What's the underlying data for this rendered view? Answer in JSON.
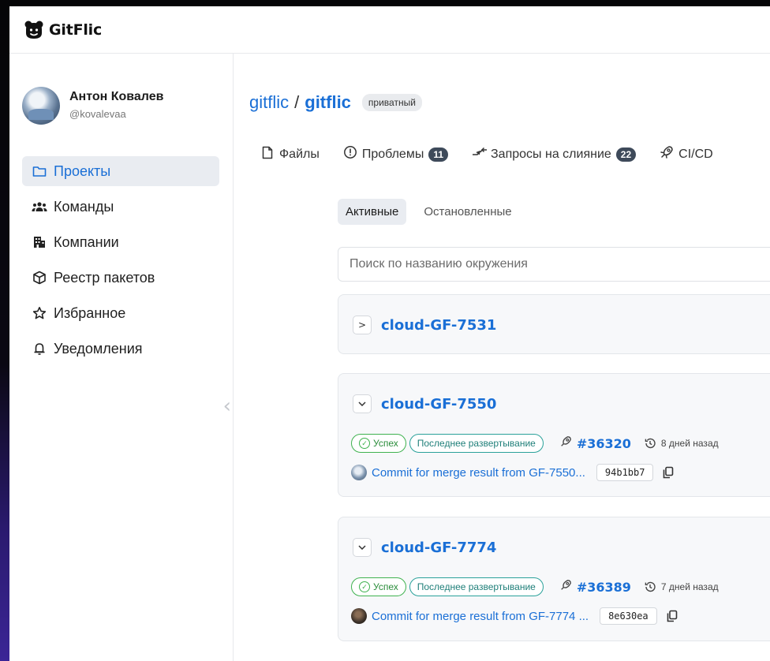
{
  "app": {
    "name": "GitFlic"
  },
  "user": {
    "name": "Антон Ковалев",
    "login": "@kovalevaa"
  },
  "sidebar": {
    "items": [
      {
        "label": "Проекты",
        "icon": "folder-icon",
        "active": true
      },
      {
        "label": "Команды",
        "icon": "users-icon"
      },
      {
        "label": "Компании",
        "icon": "buildings-icon"
      },
      {
        "label": "Реестр пакетов",
        "icon": "package-icon"
      },
      {
        "label": "Избранное",
        "icon": "star-icon"
      },
      {
        "label": "Уведомления",
        "icon": "bell-icon"
      }
    ]
  },
  "repo": {
    "owner": "gitflic",
    "separator": "/",
    "name": "gitflic",
    "visibility": "приватный"
  },
  "tabs": [
    {
      "label": "Файлы",
      "icon": "file-icon"
    },
    {
      "label": "Проблемы",
      "count": "11",
      "icon": "issue-icon"
    },
    {
      "label": "Запросы на слияние",
      "count": "22",
      "icon": "merge-icon"
    },
    {
      "label": "CI/CD",
      "icon": "rocket-icon"
    }
  ],
  "subtabs": {
    "active": "Активные",
    "stopped": "Остановленные"
  },
  "search": {
    "placeholder": "Поиск по названию окружения"
  },
  "environments": [
    {
      "name": "cloud-GF-7531",
      "expanded": false,
      "chevron": ">"
    },
    {
      "name": "cloud-GF-7550",
      "expanded": true,
      "chevron": "⌄",
      "status": "Успех",
      "deployment_label": "Последнее развертывание",
      "pipeline": "#36320",
      "time": "8 дней назад",
      "commit": "Commit for merge result from GF-7550...",
      "sha": "94b1bb7"
    },
    {
      "name": "cloud-GF-7774",
      "expanded": true,
      "chevron": "⌄",
      "status": "Успех",
      "deployment_label": "Последнее развертывание",
      "pipeline": "#36389",
      "time": "7 дней назад",
      "commit": "Commit for merge result from GF-7774 ...",
      "sha": "8e630ea"
    }
  ],
  "colors": {
    "link": "#1a6fd6",
    "success": "#3fb24f",
    "teal": "#2aa19a",
    "active_bg": "#e9ecf1"
  }
}
